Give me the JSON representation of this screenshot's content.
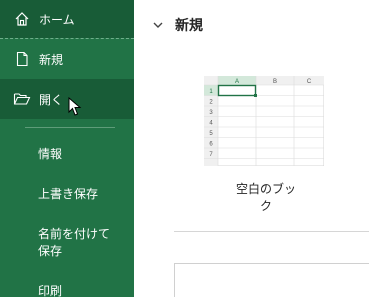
{
  "sidebar": {
    "home_label": "ホーム",
    "new_label": "新規",
    "open_label": "開く",
    "info_label": "情報",
    "overwrite_label": "上書き保存",
    "saveas_label": "名前を付けて保存",
    "print_label": "印刷"
  },
  "main": {
    "section_title": "新規",
    "template_label": "空白のブック",
    "sheet": {
      "columns": [
        "A",
        "B",
        "C"
      ],
      "rows": [
        "1",
        "2",
        "3",
        "4",
        "5",
        "6",
        "7"
      ]
    }
  },
  "colors": {
    "sidebar_bg": "#217346",
    "sidebar_selected": "#185c37",
    "accent_green": "#217346"
  },
  "icons": {
    "home": "home-icon",
    "new": "new-document-icon",
    "open": "folder-open-icon",
    "chevron": "chevron-down-icon"
  }
}
